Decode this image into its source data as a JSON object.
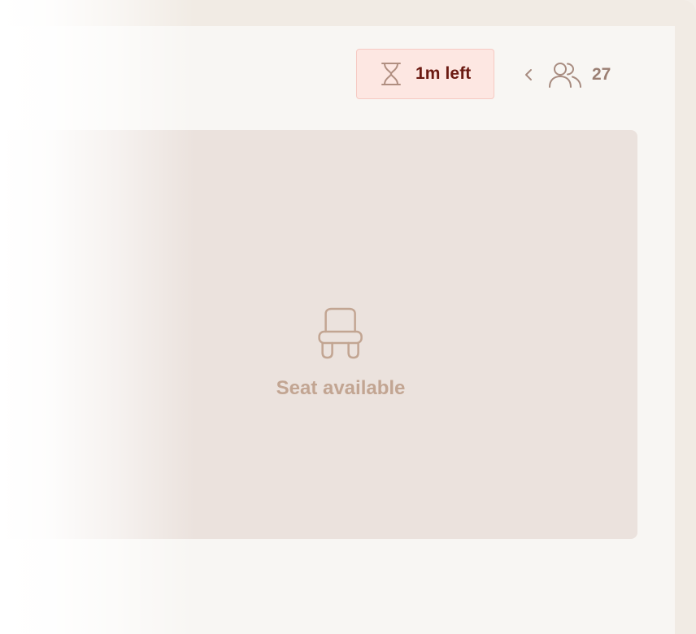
{
  "header": {
    "timer": {
      "icon": "hourglass-icon",
      "label": "1m left"
    },
    "participants": {
      "collapse_icon": "chevron-left-icon",
      "icon": "people-icon",
      "count": "27"
    }
  },
  "seat": {
    "icon": "chair-icon",
    "label": "Seat available"
  },
  "colors": {
    "timer_bg": "#fde7e2",
    "timer_border": "#f6c9c2",
    "timer_text": "#6b1a12",
    "tile_bg": "#ebe2dd",
    "seat_label": "#c2a592",
    "muted_icon": "#a88c80"
  }
}
